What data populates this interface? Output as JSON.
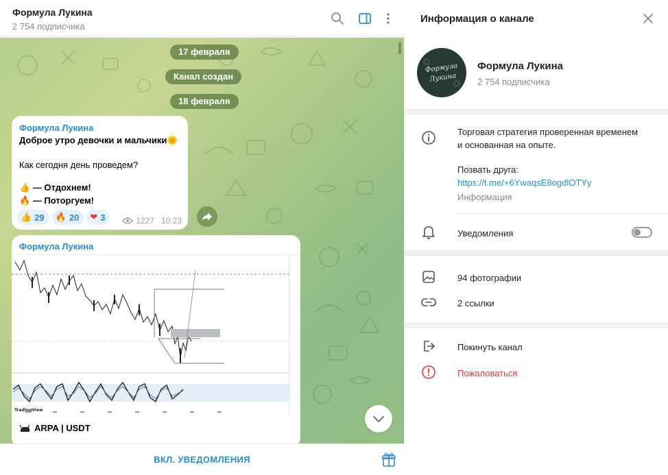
{
  "chat": {
    "title": "Формула Лукина",
    "subscribers": "2 754 подписчика",
    "date_pills": [
      "17 февраля",
      "Канал создан",
      "18 февраля"
    ],
    "message1": {
      "author": "Формула Лукина",
      "line1": "Доброе утро девочки и мальчики",
      "line2": "Как сегодня день проведем?",
      "line3": "— Отдохнем!",
      "line4": "— Поторгуем!",
      "reactions": [
        {
          "emoji": "👍",
          "count": "29"
        },
        {
          "emoji": "🔥",
          "count": "20"
        },
        {
          "emoji": "❤",
          "count": "3"
        }
      ],
      "views": "1227",
      "time": "10:23"
    },
    "message2": {
      "author": "Формула Лукина",
      "caption": "ARPA | USDT",
      "watermark": "TradingView"
    },
    "footer_button": "ВКЛ. УВЕДОМЛЕНИЯ"
  },
  "info": {
    "title": "Информация о канале",
    "name": "Формула Лукина",
    "subscribers": "2 754 подписчика",
    "avatar_text": "Формула Лукина",
    "description_line1": "Торговая стратегия проверенная временем",
    "description_line2": "и основанная на опыте.",
    "invite_label": "Позвать друга:",
    "invite_link": "https://t.me/+6YwaqsE8ogdlOTYy",
    "invite_sub": "Информация",
    "notifications": "Уведомления",
    "photos": "94 фотографии",
    "links": "2 ссылки",
    "leave": "Покинуть канал",
    "report": "Пожаловаться"
  },
  "colors": {
    "accent": "#2b8ccc",
    "danger": "#e5393b",
    "pill_bg": "#5c7a40"
  },
  "icons": [
    "search-icon",
    "side-panel-icon",
    "more-vertical-icon",
    "eye-icon",
    "share-icon",
    "chevron-down-icon",
    "gift-icon",
    "close-icon",
    "info-icon",
    "bell-icon",
    "image-icon",
    "link-icon",
    "leave-icon",
    "report-icon"
  ]
}
